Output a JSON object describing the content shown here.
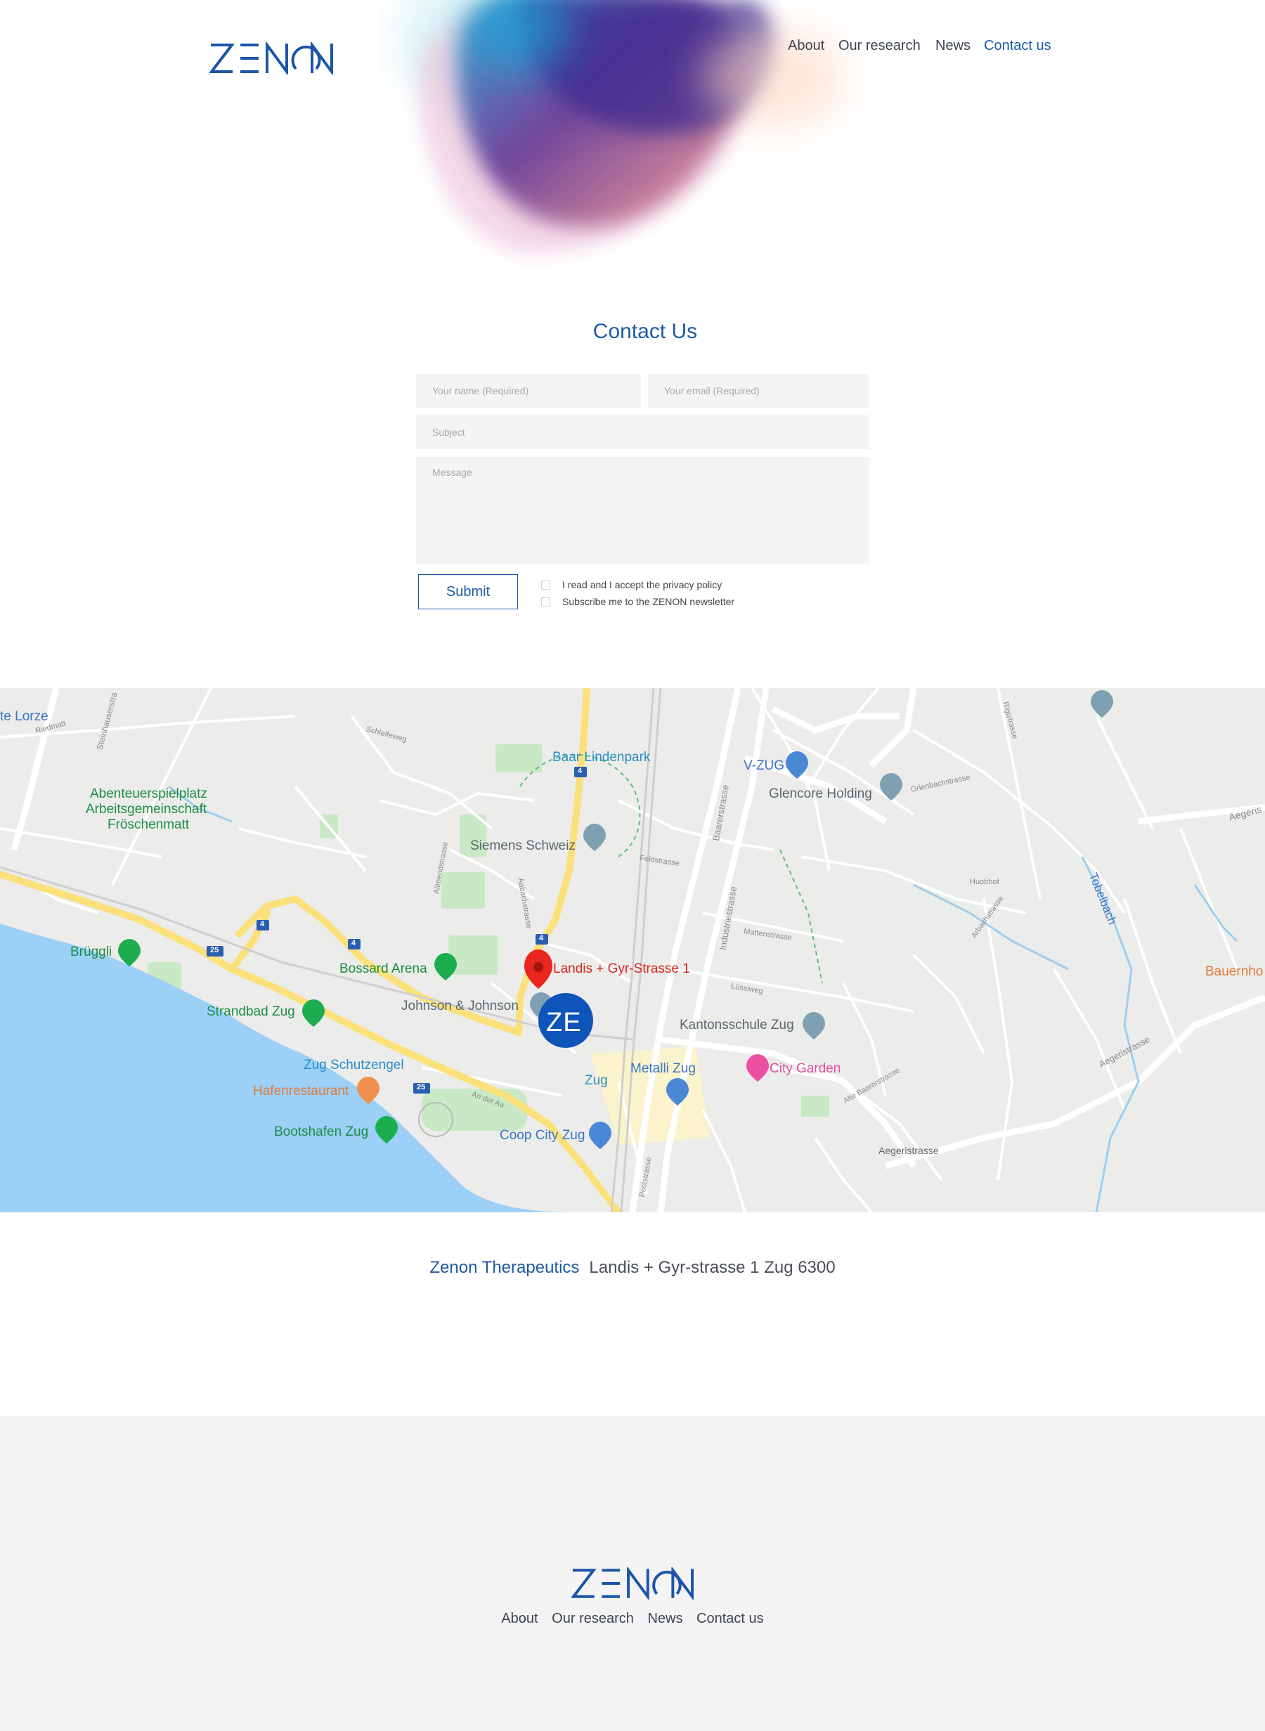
{
  "header": {
    "logo_text": "ZENON",
    "nav": [
      {
        "label": "About",
        "active": false
      },
      {
        "label": "Our research",
        "active": false
      },
      {
        "label": "News",
        "active": false
      },
      {
        "label": "Contact us",
        "active": true
      }
    ]
  },
  "contact": {
    "title": "Contact Us",
    "name_placeholder": "Your name (Required)",
    "email_placeholder": "Your email (Required)",
    "subject_placeholder": "Subject",
    "message_placeholder": "Message",
    "submit_label": "Submit",
    "privacy_label": "I read and I accept the privacy policy",
    "newsletter_label": "Subscribe me to the ZENON newsletter"
  },
  "map": {
    "marker_label": "Landis + Gyr-Strasse 1",
    "zenon_marker": "ZE",
    "places": {
      "baar_lindenpark": "Baar Lindenpark",
      "v_zug": "V-ZUG",
      "glencore": "Glencore Holding",
      "siemens": "Siemens Schweiz",
      "abenteuer": "Abenteuerspielplatz",
      "arbeits": "Arbeitsgemeinschaft",
      "froschenmatt": "Fröschenmatt",
      "bruggli": "Brüggli",
      "bossard": "Bossard Arena",
      "johnson": "Johnson & Johnson",
      "strandbad": "Strandbad Zug",
      "kantonsschule": "Kantonsschule Zug",
      "zug_schutzengel": "Zug Schutzengel",
      "hafenrestaurant": "Hafenrestaurant",
      "metalli": "Metalli Zug",
      "city_garden": "City Garden",
      "zug_station": "Zug",
      "bootshafen": "Bootshafen Zug",
      "coop": "Coop City Zug",
      "lorze": "te Lorze",
      "bauernhof": "Bauernho",
      "tobelbach": "Tobelbach"
    },
    "streets": {
      "baarerstrasse": "Baarerstrasse",
      "industriestrasse": "Industriestrasse",
      "aegeristrasse": "Aegeristrasse",
      "aegeristrasse2": "Aegeristrasse",
      "aegeri_top": "Aegeris",
      "steinhauser": "Steinhauserstra",
      "schleifeweg": "Schleifeweg",
      "feldstrasse": "Feldstrasse",
      "lussiweg": "Lüssiweg",
      "mattenstrasse": "Mattenstrasse",
      "rigistrasse": "Rigistrasse",
      "poststrasse": "Poststrasse",
      "allmend": "Allmendstrasse",
      "aabach": "Aabachstrasse",
      "anderaa": "An der Aa",
      "grienbach": "Grienbachstrasse",
      "arbach": "Arbachstrasse",
      "riedmatt": "Riedmatt",
      "alte_baarer": "Alte Baarerstrasse",
      "huobhof": "Huobhof"
    },
    "road_numbers": {
      "r4a": "4",
      "r4b": "4",
      "r4c": "4",
      "r4d": "4",
      "r25a": "25",
      "r25b": "25"
    }
  },
  "address": {
    "company": "Zenon Therapeutics",
    "line": "Landis + Gyr-strasse 1  Zug  6300"
  },
  "footer": {
    "logo_text": "ZENON",
    "nav": [
      "About",
      "Our research",
      "News",
      "Contact us"
    ]
  },
  "colors": {
    "brand_blue": "#1e5ba4",
    "footer_bg": "#f4f4f4",
    "field_bg": "#f4f4f4",
    "water": "#9cd0f7",
    "marker_red": "#e8261f"
  }
}
